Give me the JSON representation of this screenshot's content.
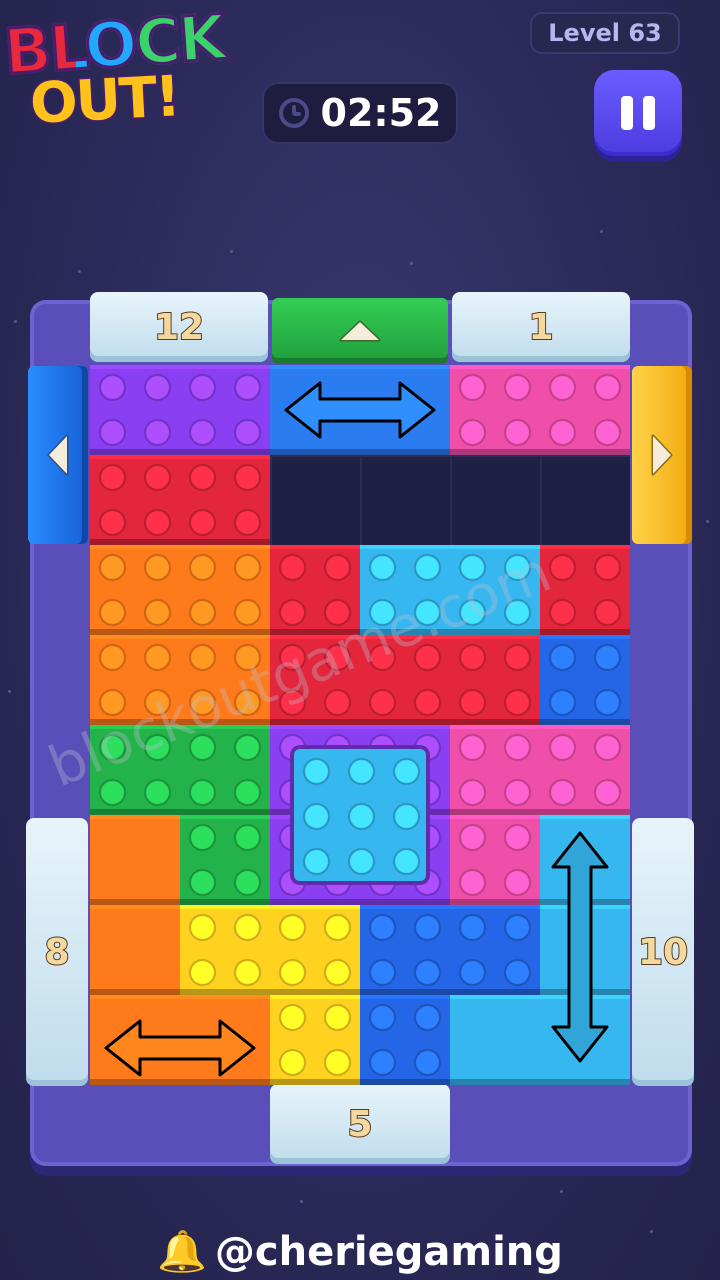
{
  "logo": {
    "line1": "BLOCK",
    "line2": "OUT!"
  },
  "header": {
    "level": "Level 63",
    "timer": "02:52"
  },
  "gates": {
    "top_left": "12",
    "top_right": "1",
    "left": "8",
    "right": "10",
    "bottom": "5"
  },
  "watermark": "blockoutgame.com",
  "footer": {
    "handle": "@cheriegaming"
  },
  "icons": [
    "clock-icon",
    "pause-icon",
    "up-arrow-icon",
    "left-arrow-icon",
    "right-arrow-icon",
    "bell-icon"
  ],
  "colors": {
    "purple": "#8a3ff2",
    "blue": "#2a7cf0",
    "pink": "#f04fa9",
    "red": "#e3263b",
    "orange": "#ff7a1a",
    "cyan": "#36b7f0",
    "royal": "#2466e6",
    "green": "#23b34a",
    "yellow": "#ffd21f",
    "gate_green": "#27b745",
    "gate_blue": "#1f7be8",
    "gate_yellow": "#ffc61a"
  }
}
